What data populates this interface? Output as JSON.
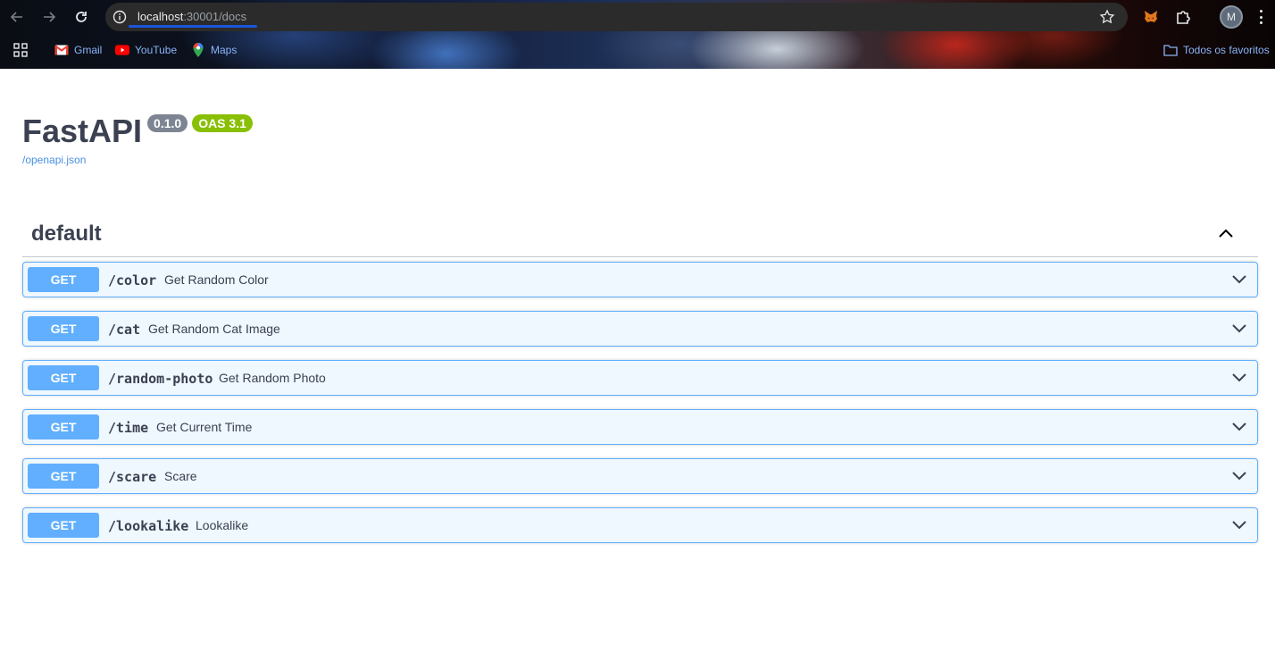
{
  "browser": {
    "url_host": "localhost",
    "url_rest": ":30001/docs",
    "avatar_letter": "M",
    "bookmarks": [
      {
        "label": "Gmail",
        "icon": "gmail-icon"
      },
      {
        "label": "YouTube",
        "icon": "youtube-icon"
      },
      {
        "label": "Maps",
        "icon": "maps-icon"
      }
    ],
    "all_bookmarks_label": "Todos os favoritos"
  },
  "api": {
    "title": "FastAPI",
    "version": "0.1.0",
    "oas": "OAS 3.1",
    "spec_link": "/openapi.json"
  },
  "section": {
    "title": "default",
    "operations": [
      {
        "method": "GET",
        "path": "/color",
        "summary": "Get Random Color"
      },
      {
        "method": "GET",
        "path": "/cat",
        "summary": "Get Random Cat Image"
      },
      {
        "method": "GET",
        "path": "/random-photo",
        "summary": "Get Random Photo"
      },
      {
        "method": "GET",
        "path": "/time",
        "summary": "Get Current Time"
      },
      {
        "method": "GET",
        "path": "/scare",
        "summary": "Scare"
      },
      {
        "method": "GET",
        "path": "/lookalike",
        "summary": "Lookalike"
      }
    ]
  },
  "colors": {
    "get_method": "#61affe",
    "title_text": "#3b4151",
    "link": "#4990e2",
    "version_badge": "#7d8492",
    "oas_badge": "#89bf04"
  }
}
